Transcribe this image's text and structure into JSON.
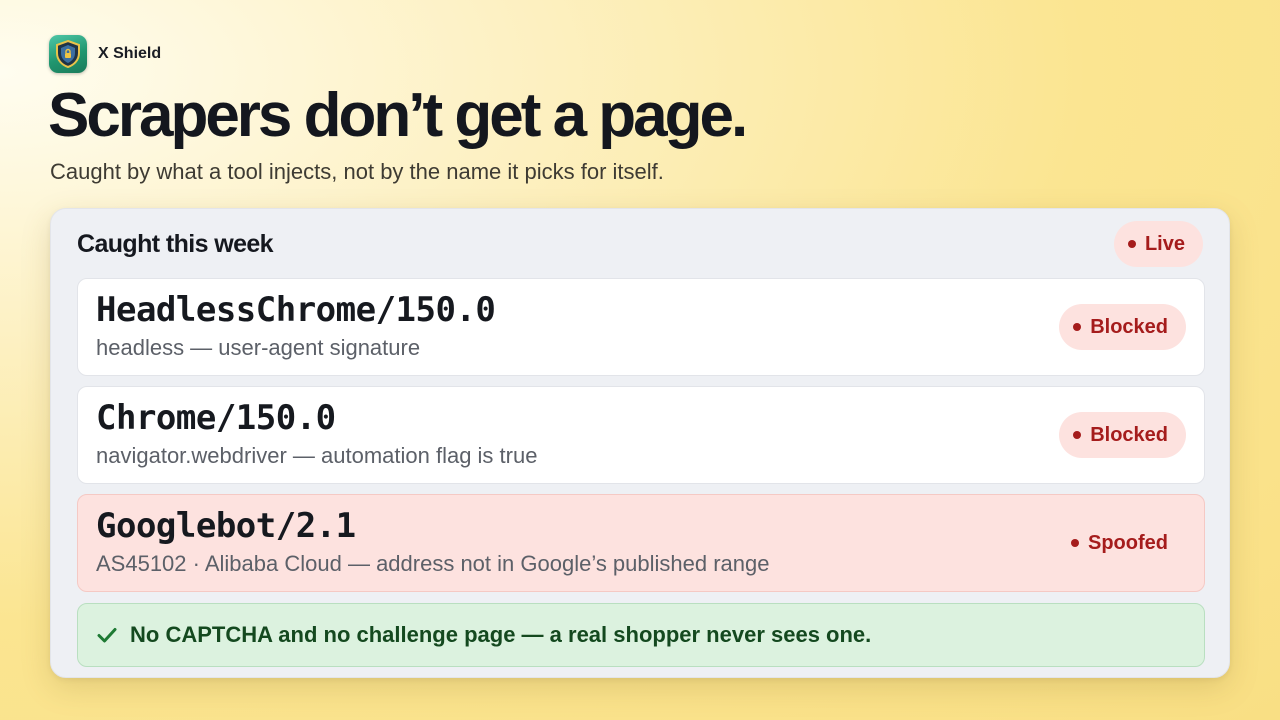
{
  "brand": {
    "name": "X Shield",
    "icon": "shield-icon"
  },
  "headline": "Scrapers don’t get a page.",
  "subline": "Caught by what a tool injects, not by the name it picks for itself.",
  "panel": {
    "title": "Caught this week",
    "live_label": "Live",
    "rows": [
      {
        "user_agent": "HeadlessChrome/150.0",
        "reason": "headless — user-agent signature",
        "status": "Blocked"
      },
      {
        "user_agent": "Chrome/150.0",
        "reason": "navigator.webdriver — automation flag is true",
        "status": "Blocked"
      },
      {
        "user_agent": "Googlebot/2.1",
        "reason": "AS45102 · Alibaba Cloud — address not in Google’s published range",
        "status": "Spoofed"
      }
    ],
    "note": "No CAPTCHA and no challenge page — a real shopper never sees one."
  },
  "colors": {
    "status_red": "#a51c1c",
    "status_bg": "#fde2df",
    "success_green": "#1e7a34",
    "success_bg": "#dcf2df"
  }
}
